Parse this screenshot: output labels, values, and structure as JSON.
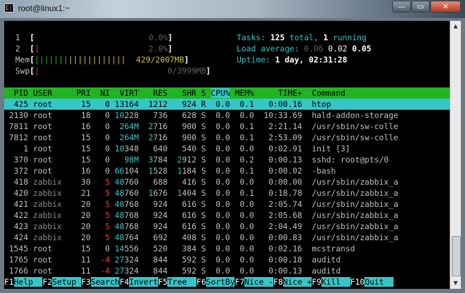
{
  "window": {
    "title": "root@linux1:~",
    "icon_label": "C:\\",
    "buttons": {
      "minimize": "—",
      "maximize": "▭",
      "close": "✕"
    }
  },
  "meters": {
    "cpu1": {
      "label": "1",
      "bar": "",
      "value": "0.0%"
    },
    "cpu2": {
      "label": "2",
      "bar": "|",
      "value": "2.0%"
    },
    "mem": {
      "label": "Mem",
      "bar_green": "||||||",
      "bar_blue": "|",
      "bar_yellow": "||||||||||||",
      "value": "429/2007MB"
    },
    "swp": {
      "label": "Swp",
      "bar": "|",
      "value": "0/3999MB"
    }
  },
  "summary": {
    "tasks_label": "Tasks:",
    "tasks_total": "125",
    "tasks_total_suffix": "total,",
    "tasks_running": "1",
    "tasks_running_suffix": "running",
    "load_label": "Load average:",
    "load_1": "0.06",
    "load_5": "0.02",
    "load_15": "0.05",
    "uptime_label": "Uptime:",
    "uptime_value": "1 day, 02:31:28"
  },
  "columns": [
    "PID",
    "USER",
    "PRI",
    "NI",
    "VIRT",
    "RES",
    "SHR",
    "S",
    "CPU%",
    "MEM%",
    "TIME+",
    "Command"
  ],
  "processes": [
    {
      "pid": "425",
      "user": "root",
      "pri": "15",
      "ni": "0",
      "virt": "13164",
      "res": "1212",
      "shr": "924",
      "s": "R",
      "cpu": "0.0",
      "mem": "0.1",
      "time": "0:00.16",
      "cmd": "htop"
    },
    {
      "pid": "2130",
      "user": "root",
      "pri": "18",
      "ni": "0",
      "virt": "10228",
      "res": "736",
      "shr": "628",
      "s": "S",
      "cpu": "0.0",
      "mem": "0.0",
      "time": "10:33.69",
      "cmd": "hald-addon-storage"
    },
    {
      "pid": "7811",
      "user": "root",
      "pri": "16",
      "ni": "0",
      "virt": "264M",
      "res": "2716",
      "shr": "900",
      "s": "S",
      "cpu": "0.0",
      "mem": "0.1",
      "time": "2:21.14",
      "cmd": "/usr/sbin/sw-colle"
    },
    {
      "pid": "7812",
      "user": "root",
      "pri": "15",
      "ni": "0",
      "virt": "264M",
      "res": "2716",
      "shr": "900",
      "s": "S",
      "cpu": "0.0",
      "mem": "0.1",
      "time": "2:53.09",
      "cmd": "/usr/sbin/sw-colle"
    },
    {
      "pid": "1",
      "user": "root",
      "pri": "15",
      "ni": "0",
      "virt": "10348",
      "res": "640",
      "shr": "540",
      "s": "S",
      "cpu": "0.0",
      "mem": "0.0",
      "time": "0:02.91",
      "cmd": "init [3]"
    },
    {
      "pid": "370",
      "user": "root",
      "pri": "15",
      "ni": "0",
      "virt": "98M",
      "res": "3784",
      "shr": "2912",
      "s": "S",
      "cpu": "0.0",
      "mem": "0.2",
      "time": "0:00.13",
      "cmd": "sshd: root@pts/0"
    },
    {
      "pid": "372",
      "user": "root",
      "pri": "16",
      "ni": "0",
      "virt": "66104",
      "res": "1528",
      "shr": "1184",
      "s": "S",
      "cpu": "0.0",
      "mem": "0.1",
      "time": "0:00.02",
      "cmd": "-bash"
    },
    {
      "pid": "418",
      "user": "zabbix",
      "pri": "30",
      "ni": "5",
      "virt": "48760",
      "res": "688",
      "shr": "416",
      "s": "S",
      "cpu": "0.0",
      "mem": "0.0",
      "time": "0:00.00",
      "cmd": "/usr/sbin/zabbix_a"
    },
    {
      "pid": "420",
      "user": "zabbix",
      "pri": "21",
      "ni": "5",
      "virt": "48760",
      "res": "1676",
      "shr": "1404",
      "s": "S",
      "cpu": "0.0",
      "mem": "0.1",
      "time": "0:18.78",
      "cmd": "/usr/sbin/zabbix_a"
    },
    {
      "pid": "421",
      "user": "zabbix",
      "pri": "20",
      "ni": "5",
      "virt": "48768",
      "res": "924",
      "shr": "616",
      "s": "S",
      "cpu": "0.0",
      "mem": "0.0",
      "time": "2:05.74",
      "cmd": "/usr/sbin/zabbix_a"
    },
    {
      "pid": "422",
      "user": "zabbix",
      "pri": "20",
      "ni": "5",
      "virt": "48768",
      "res": "924",
      "shr": "616",
      "s": "S",
      "cpu": "0.0",
      "mem": "0.0",
      "time": "2:05.68",
      "cmd": "/usr/sbin/zabbix_a"
    },
    {
      "pid": "423",
      "user": "zabbix",
      "pri": "20",
      "ni": "5",
      "virt": "48768",
      "res": "924",
      "shr": "616",
      "s": "S",
      "cpu": "0.0",
      "mem": "0.0",
      "time": "2:04.49",
      "cmd": "/usr/sbin/zabbix_a"
    },
    {
      "pid": "424",
      "user": "zabbix",
      "pri": "20",
      "ni": "5",
      "virt": "48764",
      "res": "692",
      "shr": "408",
      "s": "S",
      "cpu": "0.0",
      "mem": "0.0",
      "time": "0:00.83",
      "cmd": "/usr/sbin/zabbix_a"
    },
    {
      "pid": "1545",
      "user": "root",
      "pri": "15",
      "ni": "0",
      "virt": "14556",
      "res": "520",
      "shr": "384",
      "s": "S",
      "cpu": "0.0",
      "mem": "0.0",
      "time": "0:02.16",
      "cmd": "mcstransd"
    },
    {
      "pid": "1765",
      "user": "root",
      "pri": "11",
      "ni": "-4",
      "virt": "27324",
      "res": "844",
      "shr": "592",
      "s": "S",
      "cpu": "0.0",
      "mem": "0.0",
      "time": "0:00.18",
      "cmd": "auditd"
    },
    {
      "pid": "1766",
      "user": "root",
      "pri": "11",
      "ni": "-4",
      "virt": "27324",
      "res": "844",
      "shr": "592",
      "s": "S",
      "cpu": "0.0",
      "mem": "0.0",
      "time": "0:00.13",
      "cmd": "auditd"
    }
  ],
  "footer": [
    {
      "key": "F1",
      "label": "Help  "
    },
    {
      "key": "F2",
      "label": "Setup "
    },
    {
      "key": "F3",
      "label": "Search"
    },
    {
      "key": "F4",
      "label": "Invert"
    },
    {
      "key": "F5",
      "label": "Tree  "
    },
    {
      "key": "F6",
      "label": "SortBy"
    },
    {
      "key": "F7",
      "label": "Nice -"
    },
    {
      "key": "F8",
      "label": "Nice +"
    },
    {
      "key": "F9",
      "label": "Kill  "
    },
    {
      "key": "F10",
      "label": "Quit  "
    }
  ],
  "colors": {
    "header_bg": "#22b322",
    "selected_bg": "#35c6c8",
    "terminal_bg": "#000000",
    "nice_positive": "#e04040"
  }
}
